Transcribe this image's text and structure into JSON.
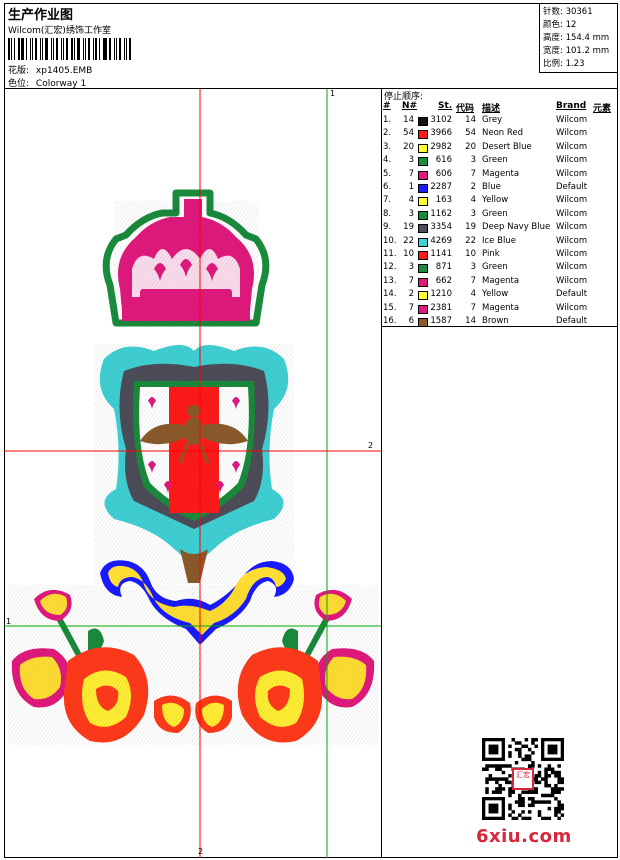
{
  "header": {
    "title": "生产作业图",
    "company": "Wilcom(汇宏)绣饰工作室",
    "design_label": "花版:",
    "design_value": "xp1405.EMB",
    "colorway_label": "色位:",
    "colorway_value": "Colorway 1"
  },
  "stats": {
    "stitches": "针数: 30361",
    "colors": "颜色: 12",
    "height": "高度: 154.4 mm",
    "width": "宽度: 101.2 mm",
    "scale": "比例: 1.23"
  },
  "guides": {
    "top_v": "1",
    "right_h": "2",
    "left_h": "1",
    "bottom_v": "2"
  },
  "stop_sequence": {
    "title": "停止顺序:",
    "headers": [
      "#",
      "N#",
      "St.",
      "代码",
      "描述",
      "Brand",
      "元素"
    ],
    "rows": [
      {
        "idx": "1.",
        "n": "14",
        "color": "#111111",
        "st": "3102",
        "code": "14",
        "desc": "Grey",
        "brand": "Wilcom"
      },
      {
        "idx": "2.",
        "n": "54",
        "color": "#ff1a1a",
        "st": "3966",
        "code": "54",
        "desc": "Neon Red",
        "brand": "Wilcom"
      },
      {
        "idx": "3.",
        "n": "20",
        "color": "#ffff33",
        "st": "2982",
        "code": "20",
        "desc": "Desert Blue",
        "brand": "Wilcom"
      },
      {
        "idx": "4.",
        "n": "3",
        "color": "#1a8a3c",
        "st": "616",
        "code": "3",
        "desc": "Green",
        "brand": "Wilcom"
      },
      {
        "idx": "5.",
        "n": "7",
        "color": "#e0197d",
        "st": "606",
        "code": "7",
        "desc": "Magenta",
        "brand": "Wilcom"
      },
      {
        "idx": "6.",
        "n": "1",
        "color": "#1a1aff",
        "st": "2287",
        "code": "2",
        "desc": "Blue",
        "brand": "Default"
      },
      {
        "idx": "7.",
        "n": "4",
        "color": "#ffff33",
        "st": "163",
        "code": "4",
        "desc": "Yellow",
        "brand": "Wilcom"
      },
      {
        "idx": "8.",
        "n": "3",
        "color": "#1a8a3c",
        "st": "1162",
        "code": "3",
        "desc": "Green",
        "brand": "Wilcom"
      },
      {
        "idx": "9.",
        "n": "19",
        "color": "#4d4d59",
        "st": "3354",
        "code": "19",
        "desc": "Deep Navy Blue",
        "brand": "Wilcom"
      },
      {
        "idx": "10.",
        "n": "22",
        "color": "#3fd0d4",
        "st": "4269",
        "code": "22",
        "desc": "Ice Blue",
        "brand": "Wilcom"
      },
      {
        "idx": "11.",
        "n": "10",
        "color": "#ff1a1a",
        "st": "1141",
        "code": "10",
        "desc": "Pink",
        "brand": "Wilcom"
      },
      {
        "idx": "12.",
        "n": "3",
        "color": "#1a8a3c",
        "st": "871",
        "code": "3",
        "desc": "Green",
        "brand": "Wilcom"
      },
      {
        "idx": "13.",
        "n": "7",
        "color": "#e0197d",
        "st": "662",
        "code": "7",
        "desc": "Magenta",
        "brand": "Wilcom"
      },
      {
        "idx": "14.",
        "n": "2",
        "color": "#ffff33",
        "st": "1210",
        "code": "4",
        "desc": "Yellow",
        "brand": "Default"
      },
      {
        "idx": "15.",
        "n": "7",
        "color": "#e0197d",
        "st": "2381",
        "code": "7",
        "desc": "Magenta",
        "brand": "Wilcom"
      },
      {
        "idx": "16.",
        "n": "6",
        "color": "#8b5a2b",
        "st": "1587",
        "code": "14",
        "desc": "Brown",
        "brand": "Default"
      }
    ]
  },
  "watermark": "6xiu.com",
  "qr_badge": "汇宏",
  "colors": {
    "guide": "#ff0000",
    "guide_alt": "#00aa00",
    "crown_outline": "#1a8a3c",
    "crown_fill": "#e0197d",
    "shield_teal": "#3fd0d4",
    "shield_gray": "#4d4d59",
    "shield_red": "#ff1a1a",
    "bee_brown": "#8b5a2b",
    "scroll_blue": "#1a1aff",
    "scroll_yellow": "#ffdd33",
    "rose_red": "#ff3a1a",
    "rose_yellow": "#ffee33"
  }
}
